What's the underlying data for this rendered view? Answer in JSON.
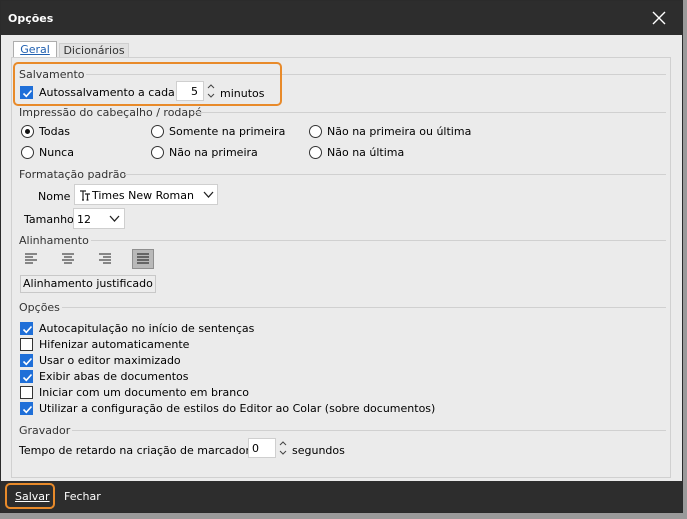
{
  "window": {
    "title": "Opções"
  },
  "tabs": [
    "Geral",
    "Dicionários"
  ],
  "salvamento": {
    "heading": "Salvamento",
    "autosave_label": "Autossalvamento a cada",
    "autosave_value": "5",
    "unit": "minutos"
  },
  "impressao": {
    "heading": "Impressão do cabeçalho / rodapé",
    "options": [
      "Todas",
      "Somente na primeira",
      "Não na primeira ou última",
      "Nunca",
      "Não na primeira",
      "Não na última"
    ],
    "selected": "Todas"
  },
  "formatacao": {
    "heading": "Formatação padrão",
    "name_label": "Nome",
    "font_icon": "truetype-font-icon",
    "font_value": "Times New Roman",
    "size_label": "Tamanho",
    "size_value": "12"
  },
  "alinhamento": {
    "heading": "Alinhamento",
    "selected_label": "Alinhamento justificado"
  },
  "opcoes": {
    "heading": "Opções",
    "items": [
      {
        "label": "Autocapitulação no início de sentenças",
        "checked": true
      },
      {
        "label": "Hifenizar automaticamente",
        "checked": false
      },
      {
        "label": "Usar o editor maximizado",
        "checked": true
      },
      {
        "label": "Exibir abas de documentos",
        "checked": true
      },
      {
        "label": "Iniciar com um documento em branco",
        "checked": false
      },
      {
        "label": "Utilizar a configuração de estilos do Editor ao Colar (sobre documentos)",
        "checked": true
      }
    ]
  },
  "gravador": {
    "heading": "Gravador",
    "delay_label": "Tempo de retardo na criação de marcadores",
    "delay_value": "0",
    "unit": "segundos"
  },
  "footer": {
    "save": "Salvar",
    "close": "Fechar"
  },
  "colors": {
    "accent": "#1f6fd8",
    "highlight": "#e88a2a",
    "titlebar": "#2d2d2d"
  }
}
